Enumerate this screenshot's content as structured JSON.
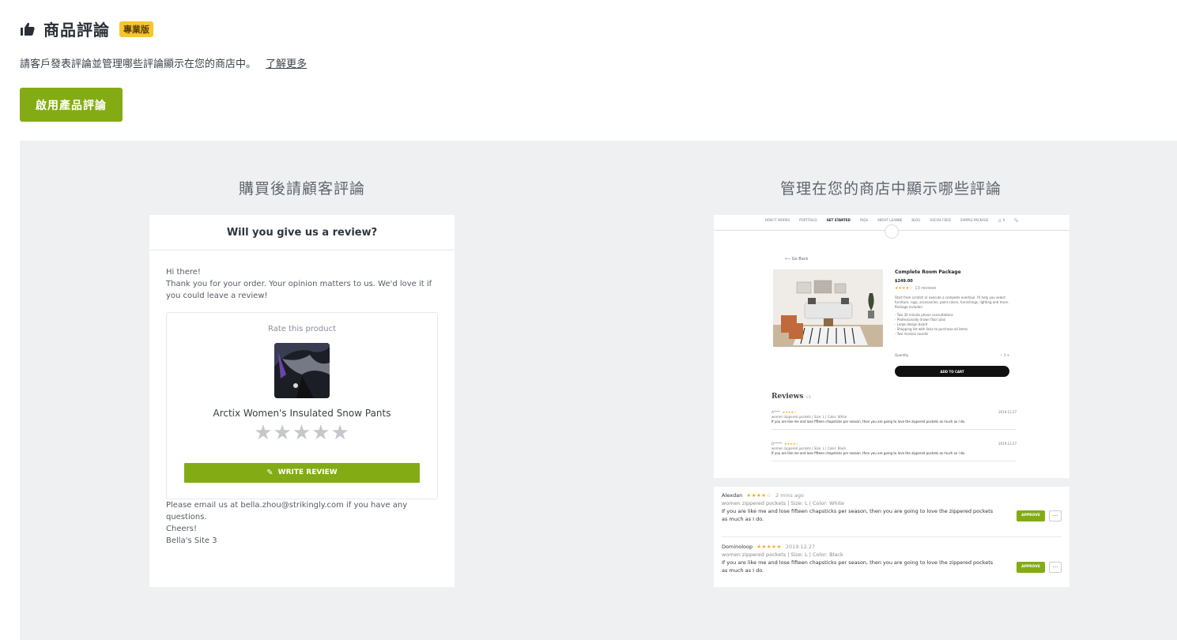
{
  "header": {
    "icon": "thumbs-up-icon",
    "title": "商品評論",
    "badge": "專業版"
  },
  "description": {
    "text": "請客戶發表評論並管理哪些評論顯示在您的商店中。",
    "link": "了解更多"
  },
  "enable_button": "啟用產品評論",
  "left_column": {
    "title": "購買後請顧客評論",
    "email": {
      "heading": "Will you give us a review?",
      "greeting": "Hi there!",
      "thanks": "Thank you for your order. Your opinion matters to us. We'd love it if you could leave a review!",
      "rate_label": "Rate this product",
      "product_name": "Arctix Women's Insulated Snow Pants",
      "stars": "★★★★★",
      "write_review": "WRITE REVIEW",
      "questions": "Please email us at bella.zhou@strikingly.com if you have any questions.",
      "cheers": "Cheers!",
      "signature": "Bella's Site 3"
    }
  },
  "right_column": {
    "title": "管理在您的商店中顯示哪些評論",
    "store": {
      "nav": [
        "HOW IT WORKS",
        "PORTFOLIO",
        "GET STARTED",
        "FAQS",
        "ABOUT LEANNE",
        "BLOG",
        "SOCIAL FEED",
        "SAMPLE PACKAGE",
        "🛒 0",
        "🔍"
      ],
      "go_back": "⟵ Go Back",
      "product_title": "Complete Room Package",
      "price": "$249.00",
      "stars": "★★★★☆",
      "review_count": "13 reviews",
      "desc": "Start from scratch or execute a complete overhaul. I'll help you select furniture, rugs, accessories, paint colors, furnishings, lighting and more. Package includes:",
      "bullets": "- Two 30 minute phone consultations\n- Professionally drawn floor plan\n- Large design board\n- Shopping list with links to purchase all items\n- Two revision rounds",
      "quantity_label": "Quantity",
      "quantity_value": "−   1   +",
      "add_to_cart": "ADD TO CART",
      "reviews_title": "Reviews",
      "reviews_count": "15",
      "mini_reviews": [
        {
          "name": "A****",
          "stars": "★★★★☆",
          "date": "2019.12.27",
          "variant": "women zippered pockets  |  Size: L  |  Color: White",
          "text": "If you are like me and lose fifteen chapsticks per season, then you are going to love the zippered pockets as much as I do."
        },
        {
          "name": "D*****",
          "stars": "★★★★☆",
          "date": "2019.12.27",
          "variant": "women zippered pockets  |  Size: L  |  Color: Black",
          "text": "If you are like me and lose fifteen chapsticks per season, then you are going to love the zippered pockets as much as I do."
        }
      ]
    },
    "moderation": [
      {
        "name": "Alexdan",
        "stars": "★★★★☆",
        "time": "2 mins ago",
        "variant": "women zippered pockets  |  Size: L  |  Color: White",
        "text": "If you are like me and lose fifteen chapsticks per season, then you are going to love the zippered pockets as much as I do.",
        "approve": "APPROVE",
        "more": "···"
      },
      {
        "name": "Dominoloop",
        "stars": "★★★★★",
        "time": "2019.12.27",
        "variant": "women zippered pockets  |  Size: L  |  Color: Black",
        "text": "If you are like me and lose fifteen chapsticks per season, then you are going to love the zippered pockets as much as I do.",
        "approve": "APPROVE",
        "more": "···"
      }
    ]
  },
  "colors": {
    "accent_green": "#83ac14",
    "badge_yellow": "#f6c530",
    "panel_bg": "#eef0f2",
    "star_gold": "#f5a623"
  }
}
